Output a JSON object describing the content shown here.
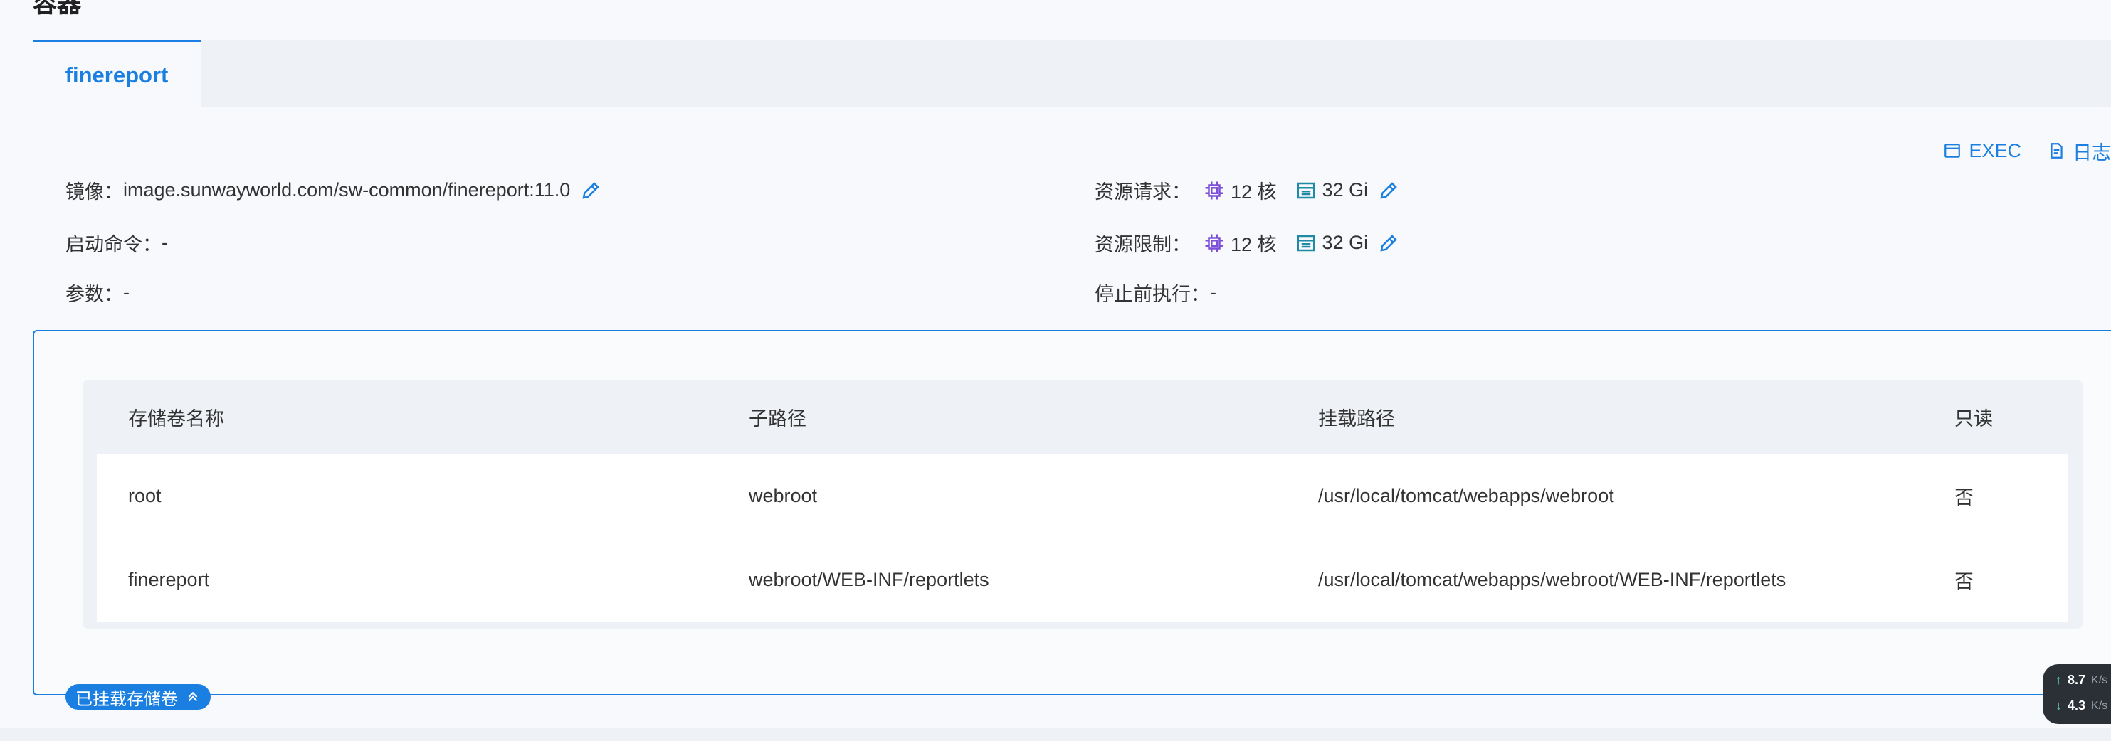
{
  "section": {
    "title": "容器"
  },
  "tabs": [
    {
      "label": "finereport",
      "active": true
    }
  ],
  "actions": {
    "exec_label": "EXEC",
    "logs_label": "日志"
  },
  "info": {
    "image_label": "镜像：",
    "image_value": "image.sunwayworld.com/sw-common/finereport:11.0",
    "command_label": "启动命令：",
    "command_value": "-",
    "args_label": "参数：",
    "args_value": "-",
    "request_label": "资源请求：",
    "request_cpu": "12 核",
    "request_mem": "32 Gi",
    "limit_label": "资源限制：",
    "limit_cpu": "12 核",
    "limit_mem": "32 Gi",
    "prestop_label": "停止前执行：",
    "prestop_value": "-"
  },
  "volumes": {
    "headers": [
      "存储卷名称",
      "子路径",
      "挂载路径",
      "只读"
    ],
    "rows": [
      [
        "root",
        "webroot",
        "/usr/local/tomcat/webapps/webroot",
        "否"
      ],
      [
        "finereport",
        "webroot/WEB-INF/reportlets",
        "/usr/local/tomcat/webapps/webroot/WEB-INF/reportlets",
        "否"
      ]
    ],
    "collapse_label": "已挂载存储卷"
  },
  "net": {
    "up": "8.7",
    "up_unit": "K/s",
    "down": "4.3",
    "down_unit": "K/s"
  },
  "colors": {
    "accent": "#1a7fe0",
    "cpu_icon": "#7b4fd6",
    "mem_icon": "#1f8aa6"
  }
}
